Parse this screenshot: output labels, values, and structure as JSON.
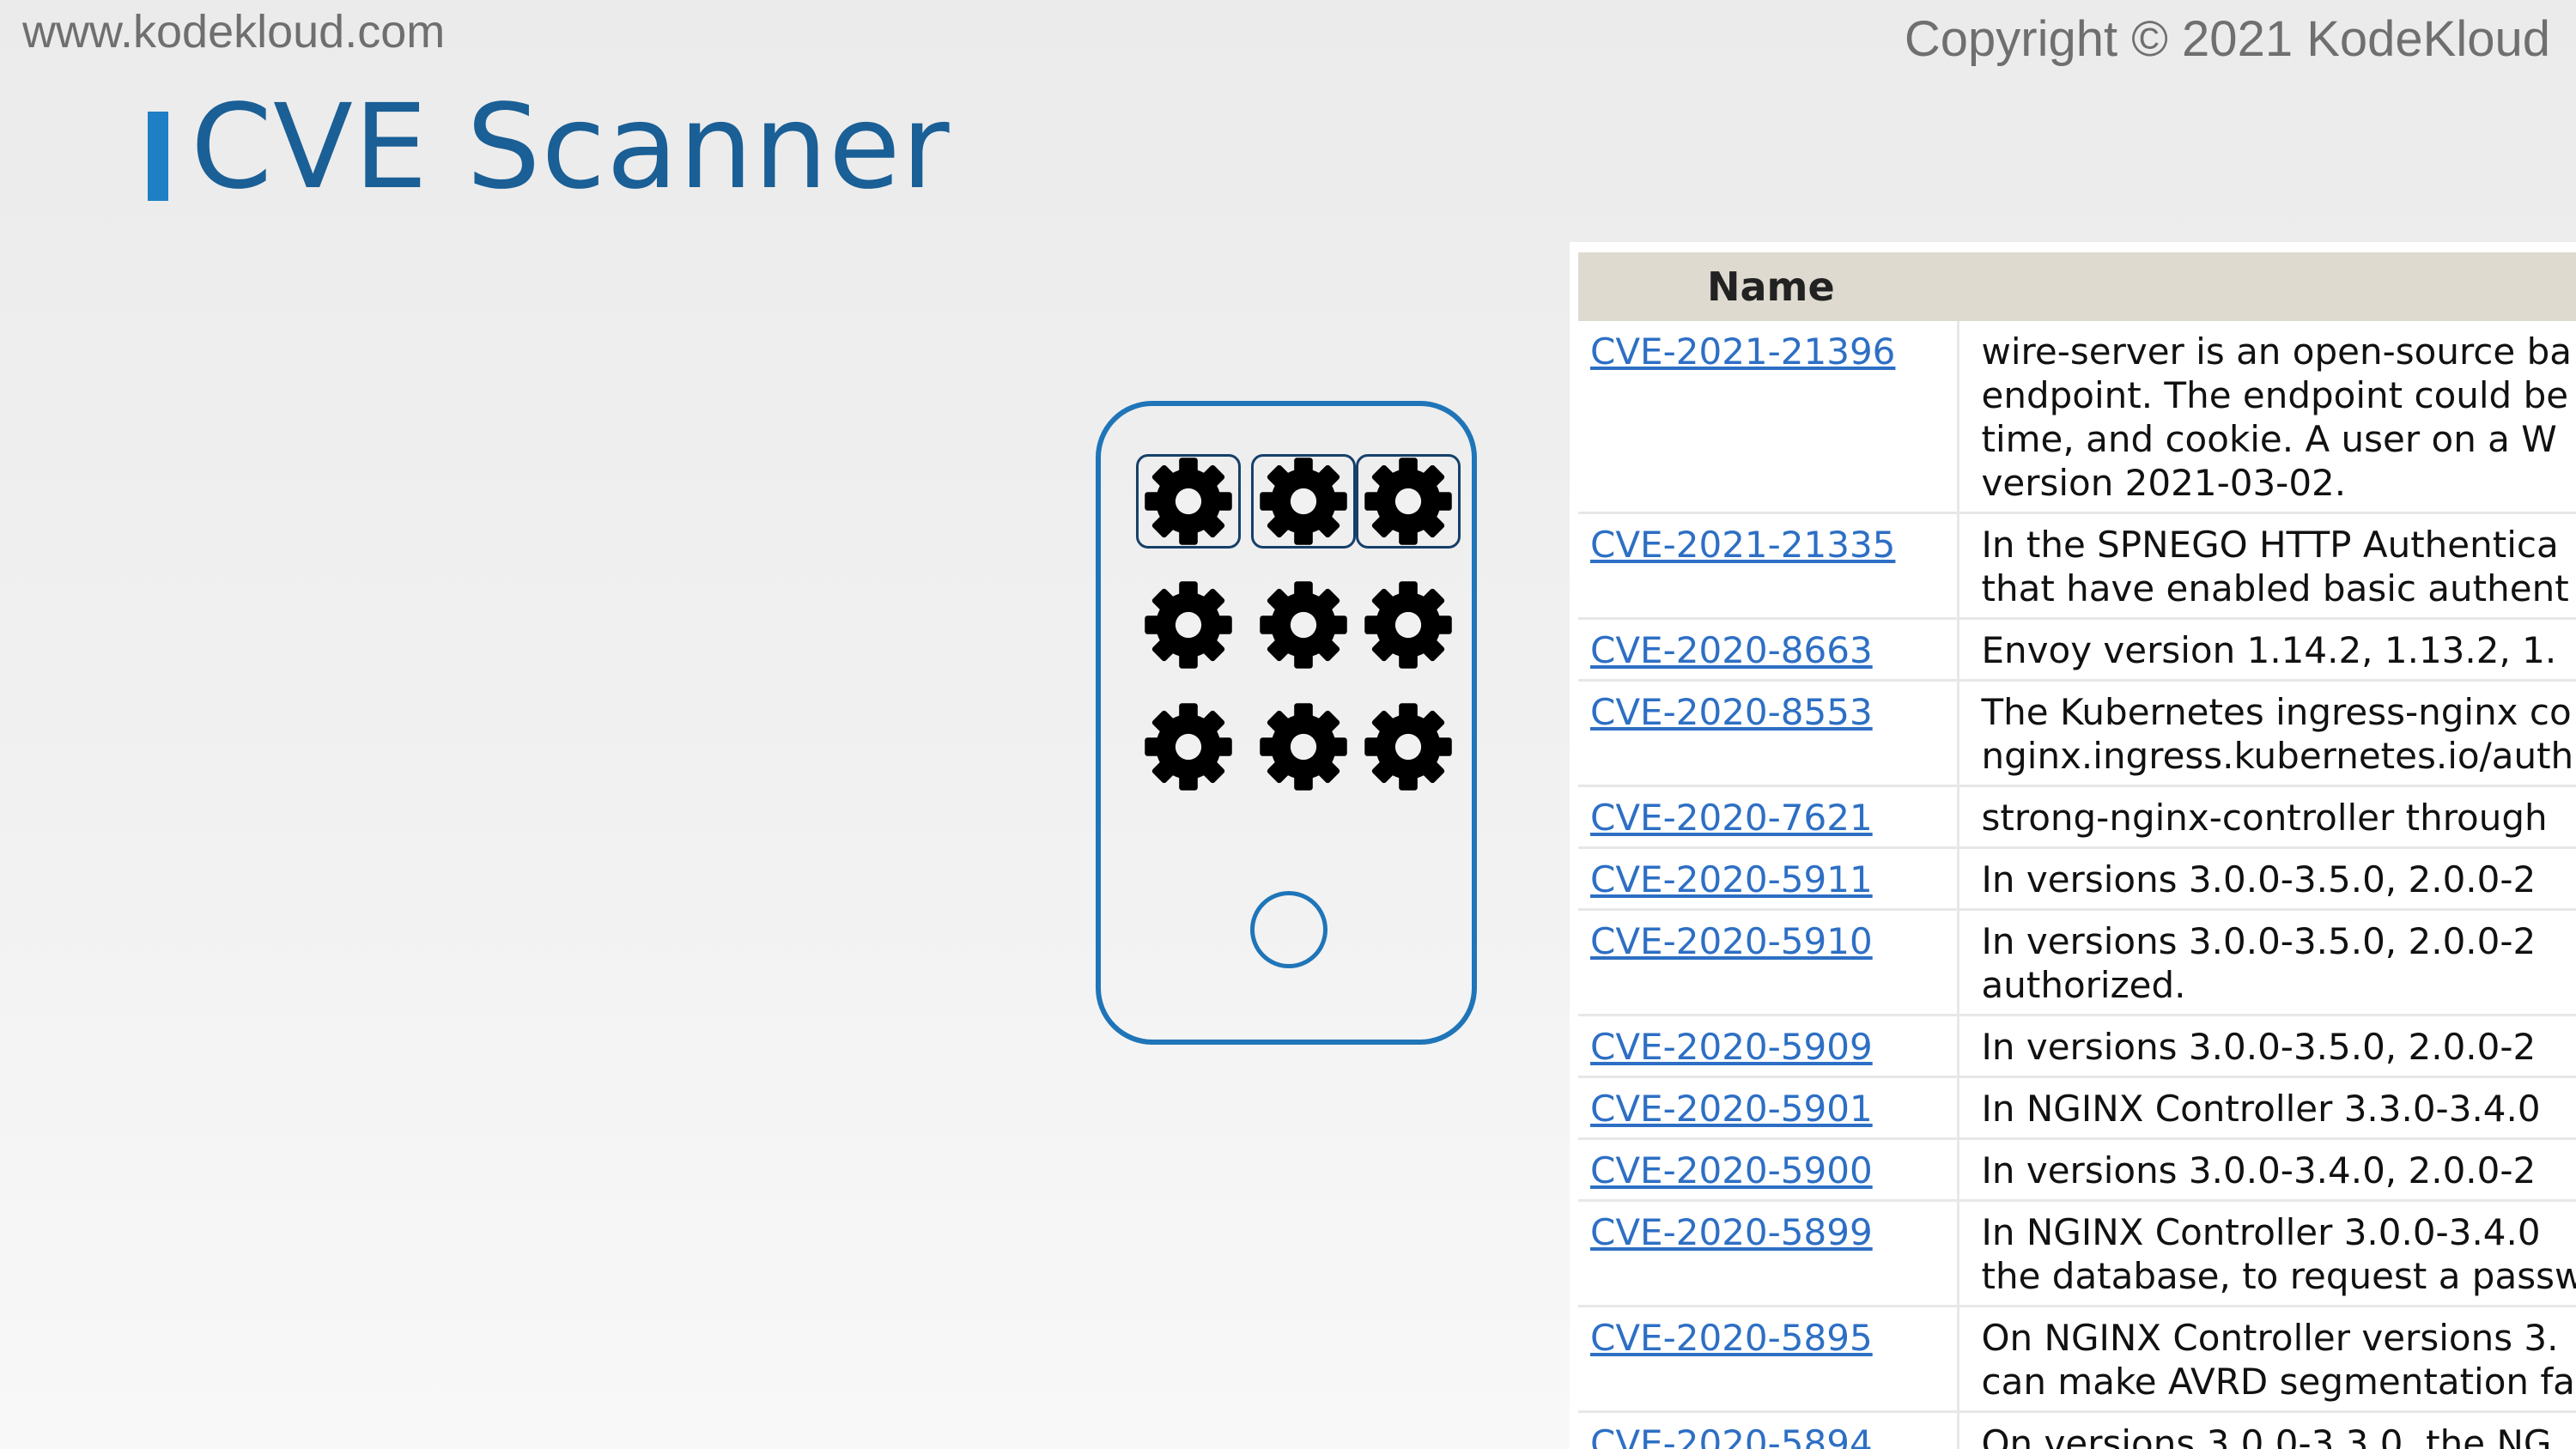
{
  "header": {
    "site_url": "www.kodekloud.com",
    "copyright": "Copyright © 2021 KodeKloud",
    "title": "CVE Scanner"
  },
  "device": {
    "icon": "gear-icon",
    "grid_rows": 3,
    "grid_cols": 3,
    "framed_row": 1,
    "accent_color": "#1f75b8"
  },
  "cve_table": {
    "header": "Name",
    "link_color": "#2d6fc4",
    "rows": [
      {
        "id": "CVE-2021-21396",
        "lines": [
          "wire-server is an open-source ba",
          "endpoint. The endpoint could be",
          "time, and cookie. A user on a W",
          "version 2021-03-02."
        ]
      },
      {
        "id": "CVE-2021-21335",
        "lines": [
          "In the SPNEGO HTTP Authentica",
          "that have enabled basic authent"
        ]
      },
      {
        "id": "CVE-2020-8663",
        "lines": [
          "Envoy version 1.14.2, 1.13.2, 1."
        ]
      },
      {
        "id": "CVE-2020-8553",
        "lines": [
          "The Kubernetes ingress-nginx co",
          "nginx.ingress.kubernetes.io/auth"
        ]
      },
      {
        "id": "CVE-2020-7621",
        "lines": [
          "strong-nginx-controller through"
        ]
      },
      {
        "id": "CVE-2020-5911",
        "lines": [
          "In versions 3.0.0-3.5.0, 2.0.0-2"
        ]
      },
      {
        "id": "CVE-2020-5910",
        "lines": [
          "In versions 3.0.0-3.5.0, 2.0.0-2",
          "authorized."
        ]
      },
      {
        "id": "CVE-2020-5909",
        "lines": [
          "In versions 3.0.0-3.5.0, 2.0.0-2"
        ]
      },
      {
        "id": "CVE-2020-5901",
        "lines": [
          "In NGINX Controller 3.3.0-3.4.0"
        ]
      },
      {
        "id": "CVE-2020-5900",
        "lines": [
          "In versions 3.0.0-3.4.0, 2.0.0-2"
        ]
      },
      {
        "id": "CVE-2020-5899",
        "lines": [
          "In NGINX Controller 3.0.0-3.4.0",
          "the database, to request a passw"
        ]
      },
      {
        "id": "CVE-2020-5895",
        "lines": [
          "On NGINX Controller versions 3.",
          "can make AVRD segmentation fa"
        ]
      },
      {
        "id": "CVE-2020-5894",
        "lines": [
          "On versions 3.0.0-3.3.0, the NG"
        ]
      }
    ]
  }
}
